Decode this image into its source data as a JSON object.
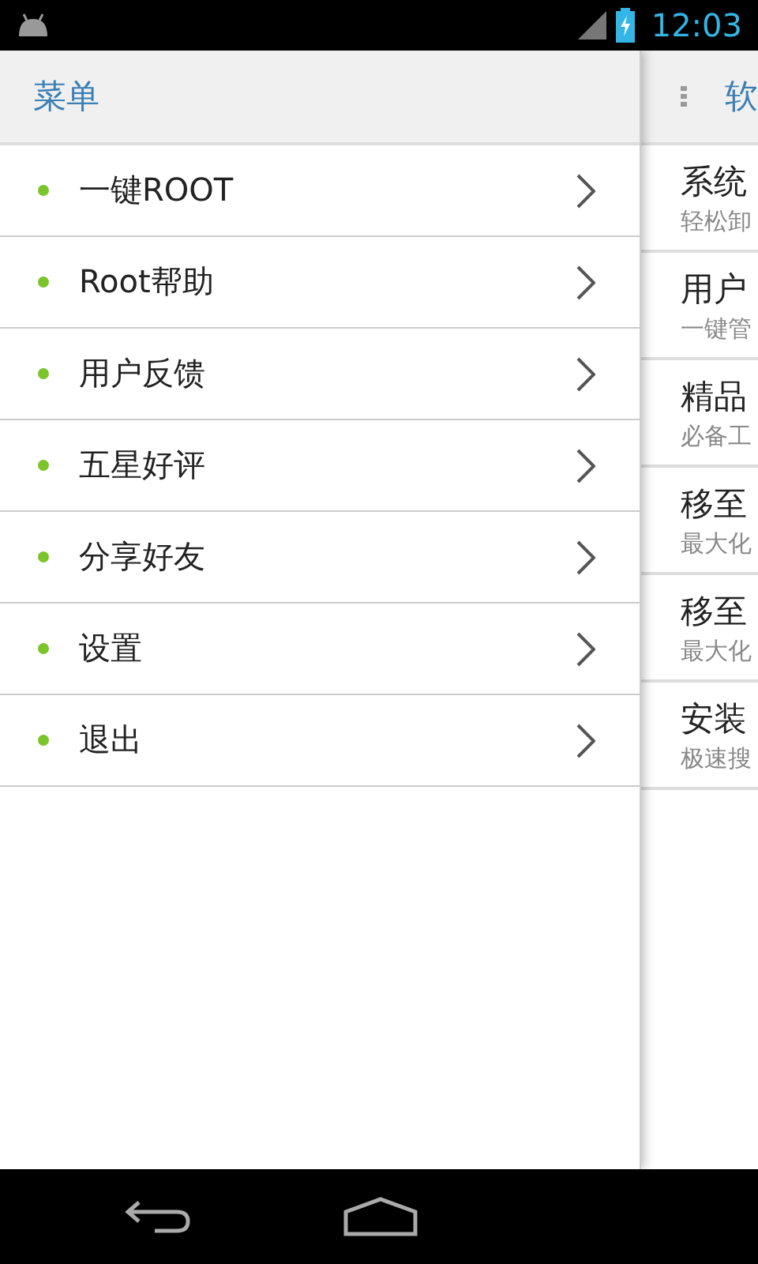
{
  "status_bar": {
    "time": "12:03"
  },
  "drawer": {
    "title": "菜单",
    "items": [
      {
        "label": "一键ROOT"
      },
      {
        "label": "Root帮助"
      },
      {
        "label": "用户反馈"
      },
      {
        "label": "五星好评"
      },
      {
        "label": "分享好友"
      },
      {
        "label": "设置"
      },
      {
        "label": "退出"
      }
    ]
  },
  "content": {
    "title": "软",
    "items": [
      {
        "title": "系统",
        "subtitle": "轻松卸"
      },
      {
        "title": "用户",
        "subtitle": "一键管"
      },
      {
        "title": "精品",
        "subtitle": "必备工"
      },
      {
        "title": "移至",
        "subtitle": "最大化"
      },
      {
        "title": "移至",
        "subtitle": "最大化"
      },
      {
        "title": "安装",
        "subtitle": "极速搜"
      }
    ]
  }
}
